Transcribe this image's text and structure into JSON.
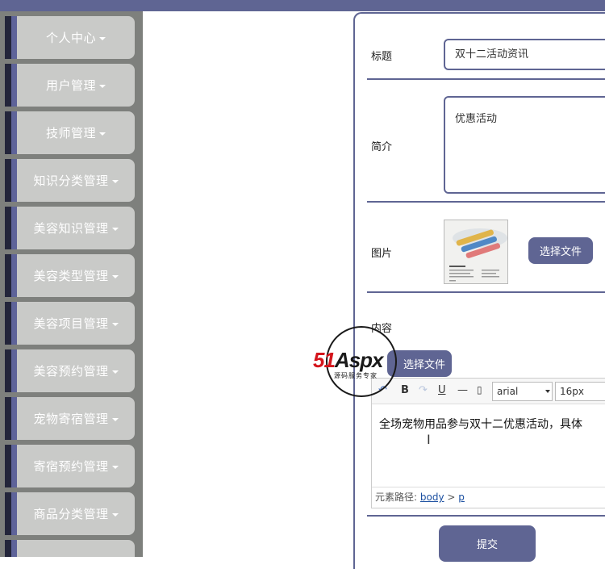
{
  "sidebar": {
    "items": [
      {
        "label": "个人中心"
      },
      {
        "label": "用户管理"
      },
      {
        "label": "技师管理"
      },
      {
        "label": "知识分类管理"
      },
      {
        "label": "美容知识管理"
      },
      {
        "label": "美容类型管理"
      },
      {
        "label": "美容项目管理"
      },
      {
        "label": "美容预约管理"
      },
      {
        "label": "宠物寄宿管理"
      },
      {
        "label": "寄宿预约管理"
      },
      {
        "label": "商品分类管理"
      }
    ]
  },
  "form": {
    "title_label": "标题",
    "title_value": "双十二活动资讯",
    "intro_label": "简介",
    "intro_value": "优惠活动",
    "image_label": "图片",
    "choose_file": "选择文件",
    "content_label": "内容",
    "content_choose_file": "选择文件",
    "submit": "提交"
  },
  "editor": {
    "font_family": "arial",
    "font_size": "16px",
    "content": "全场宠物用品参与双十二优惠活动，具体",
    "path_label": "元素路径:",
    "path_body": "body",
    "path_sep": ">",
    "path_p": "p"
  },
  "watermark": {
    "brand_51": "51",
    "brand_aspx": "Aspx",
    "tagline": "源码服务专家"
  },
  "colors": {
    "accent": "#5f6593",
    "sidebar_bg": "#7e807d",
    "menu_btn": "#c9cac8"
  }
}
